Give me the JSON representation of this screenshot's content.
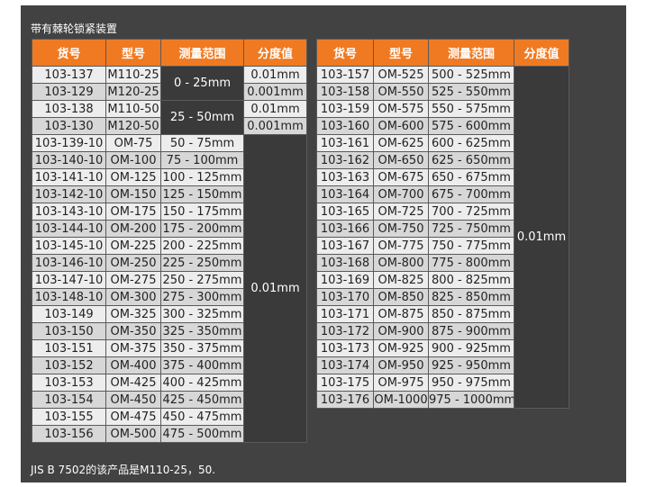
{
  "title": "带有棘轮锁紧装置",
  "footnote": "JIS B 7502的该产品是M110-25，50.",
  "headers": [
    "货号",
    "型号",
    "测量范围",
    "分度值"
  ],
  "left_rows": [
    {
      "code": "103-137",
      "model": "M110-25",
      "range": "0 - 25mm",
      "div": "0.01mm"
    },
    {
      "code": "103-129",
      "model": "M120-25",
      "range": "",
      "div": "0.001mm"
    },
    {
      "code": "103-138",
      "model": "M110-50",
      "range": "25 - 50mm",
      "div": "0.01mm"
    },
    {
      "code": "103-130",
      "model": "M120-50",
      "range": "",
      "div": "0.001mm"
    },
    {
      "code": "103-139-10",
      "model": "OM-75",
      "range": "50 - 75mm",
      "div": "0.01mm"
    },
    {
      "code": "103-140-10",
      "model": "OM-100",
      "range": "75 - 100mm"
    },
    {
      "code": "103-141-10",
      "model": "OM-125",
      "range": "100 - 125mm"
    },
    {
      "code": "103-142-10",
      "model": "OM-150",
      "range": "125 - 150mm"
    },
    {
      "code": "103-143-10",
      "model": "OM-175",
      "range": "150 - 175mm"
    },
    {
      "code": "103-144-10",
      "model": "OM-200",
      "range": "175 - 200mm"
    },
    {
      "code": "103-145-10",
      "model": "OM-225",
      "range": "200 - 225mm"
    },
    {
      "code": "103-146-10",
      "model": "OM-250",
      "range": "225 - 250mm"
    },
    {
      "code": "103-147-10",
      "model": "OM-275",
      "range": "250 - 275mm"
    },
    {
      "code": "103-148-10",
      "model": "OM-300",
      "range": "275 - 300mm"
    },
    {
      "code": "103-149",
      "model": "OM-325",
      "range": "300 - 325mm"
    },
    {
      "code": "103-150",
      "model": "OM-350",
      "range": "325 - 350mm"
    },
    {
      "code": "103-151",
      "model": "OM-375",
      "range": "350 - 375mm"
    },
    {
      "code": "103-152",
      "model": "OM-400",
      "range": "375 - 400mm"
    },
    {
      "code": "103-153",
      "model": "OM-425",
      "range": "400 - 425mm"
    },
    {
      "code": "103-154",
      "model": "OM-450",
      "range": "425 - 450mm"
    },
    {
      "code": "103-155",
      "model": "OM-475",
      "range": "450 - 475mm"
    },
    {
      "code": "103-156",
      "model": "OM-500",
      "range": "475 - 500mm"
    }
  ],
  "right_rows": [
    {
      "code": "103-157",
      "model": "OM-525",
      "range": "500 - 525mm",
      "div": "0.01mm"
    },
    {
      "code": "103-158",
      "model": "OM-550",
      "range": "525 - 550mm"
    },
    {
      "code": "103-159",
      "model": "OM-575",
      "range": "550 - 575mm"
    },
    {
      "code": "103-160",
      "model": "OM-600",
      "range": "575 - 600mm"
    },
    {
      "code": "103-161",
      "model": "OM-625",
      "range": "600 - 625mm"
    },
    {
      "code": "103-162",
      "model": "OM-650",
      "range": "625 - 650mm"
    },
    {
      "code": "103-163",
      "model": "OM-675",
      "range": "650 - 675mm"
    },
    {
      "code": "103-164",
      "model": "OM-700",
      "range": "675 - 700mm"
    },
    {
      "code": "103-165",
      "model": "OM-725",
      "range": "700 - 725mm"
    },
    {
      "code": "103-166",
      "model": "OM-750",
      "range": "725 - 750mm"
    },
    {
      "code": "103-167",
      "model": "OM-775",
      "range": "750 - 775mm"
    },
    {
      "code": "103-168",
      "model": "OM-800",
      "range": "775 - 800mm"
    },
    {
      "code": "103-169",
      "model": "OM-825",
      "range": "800 - 825mm"
    },
    {
      "code": "103-170",
      "model": "OM-850",
      "range": "825 - 850mm"
    },
    {
      "code": "103-171",
      "model": "OM-875",
      "range": "850 - 875mm"
    },
    {
      "code": "103-172",
      "model": "OM-900",
      "range": "875 - 900mm"
    },
    {
      "code": "103-173",
      "model": "OM-925",
      "range": "900 - 925mm"
    },
    {
      "code": "103-174",
      "model": "OM-950",
      "range": "925 - 950mm"
    },
    {
      "code": "103-175",
      "model": "OM-975",
      "range": "950 - 975mm"
    },
    {
      "code": "103-176",
      "model": "OM-1000",
      "range": "975 - 1000mm"
    }
  ]
}
